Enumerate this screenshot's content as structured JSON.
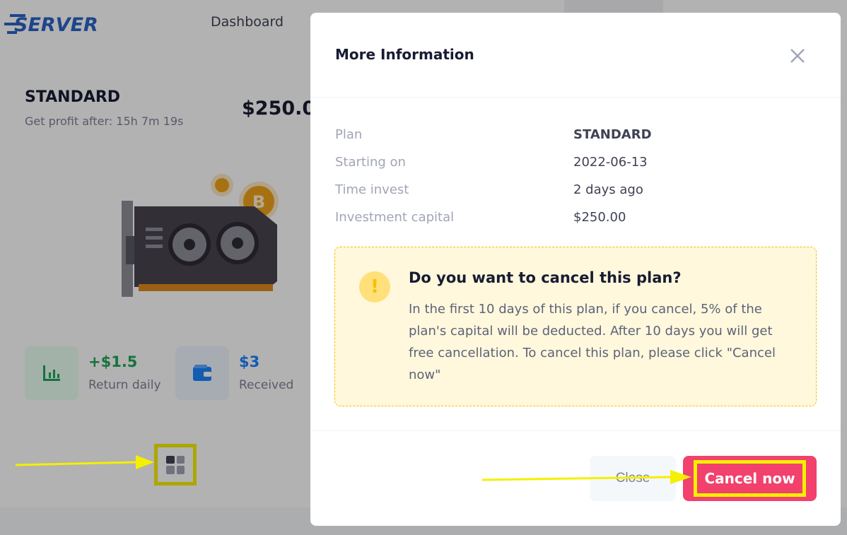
{
  "brand": {
    "logo_text": "SERVER"
  },
  "nav": {
    "dashboard": "Dashboard"
  },
  "plan_card": {
    "title": "STANDARD",
    "subtitle": "Get profit after: 15h 7m 19s",
    "price": "$250.0",
    "stats": [
      {
        "value": "+$1.5",
        "label": "Return daily",
        "icon": "chart-bar-icon"
      },
      {
        "value": "$3",
        "label": "Received",
        "icon": "wallet-icon"
      }
    ]
  },
  "modal": {
    "title": "More Information",
    "rows": [
      {
        "label": "Plan",
        "value": "STANDARD"
      },
      {
        "label": "Starting on",
        "value": "2022-06-13"
      },
      {
        "label": "Time invest",
        "value": "2 days ago"
      },
      {
        "label": "Investment capital",
        "value": "$250.00"
      }
    ],
    "notice": {
      "icon": "!",
      "title": "Do you want to cancel this plan?",
      "text": "In the first 10 days of this plan, if you cancel, 5% of the plan's capital will be deducted. After 10 days you will get free cancellation. To cancel this plan, please click \"Cancel now\""
    },
    "buttons": {
      "close": "Close",
      "cancel": "Cancel now"
    }
  },
  "colors": {
    "accent": "#f1416c",
    "highlight": "#f5ef00",
    "brand": "#2b63c7"
  }
}
